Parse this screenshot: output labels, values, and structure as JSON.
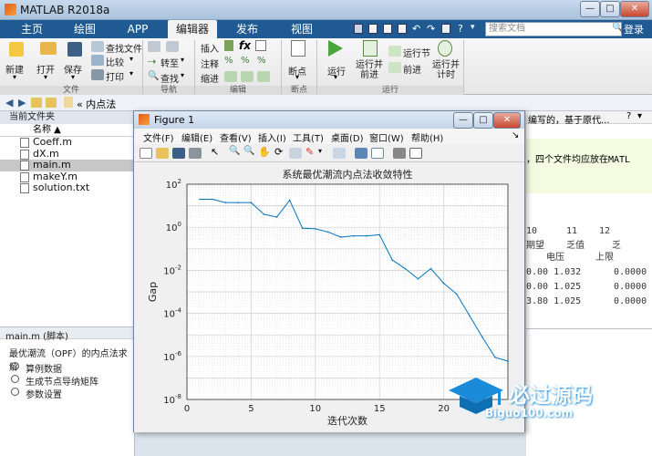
{
  "app": {
    "title": "MATLAB R2018a"
  },
  "tabs": [
    "主页",
    "绘图",
    "APP",
    "编辑器",
    "发布",
    "视图"
  ],
  "active_tab": "编辑器",
  "search": {
    "placeholder": "搜索文档"
  },
  "login": "登录",
  "ribbon": {
    "file": {
      "new": "新建",
      "open": "打开",
      "save": "保存",
      "find_files": "查找文件",
      "compare": "比较",
      "print": "打印",
      "group": "文件"
    },
    "nav": {
      "goto": "转至",
      "find": "查找",
      "group": "导航"
    },
    "edit": {
      "insert": "插入",
      "comment": "注释",
      "indent": "缩进",
      "group": "编辑"
    },
    "breakpoints": {
      "label": "断点",
      "group": "断点"
    },
    "run": {
      "run": "运行",
      "run_advance": "运行并\n前进",
      "run_section": "运行节",
      "advance": "前进",
      "run_time": "运行并\n计时",
      "group": "运行"
    }
  },
  "address": {
    "path": "« 内点法"
  },
  "left_panel": {
    "title": "当前文件夹",
    "col_name": "名称 ▲",
    "files": [
      "Coeff.m",
      "dX.m",
      "main.m",
      "makeY.m",
      "solution.txt"
    ],
    "selected": "main.m",
    "details_title": "main.m  (脚本)",
    "details_desc": "最优潮流（OPF）的内点法求解",
    "sections": [
      "算例数据",
      "生成节点导纳矩阵",
      "参数设置"
    ]
  },
  "right_pane": {
    "top_note": "编写的，基于原代...",
    "note_line": "，四个文件均应放在MATL",
    "headers": [
      "10",
      "11",
      "12"
    ],
    "header2": [
      "期望",
      "乏值",
      "乏"
    ],
    "header3": [
      "电压",
      "上限",
      ""
    ],
    "rows": [
      [
        "0.00 1.032",
        "0.0000"
      ],
      [
        "0.00 1.025",
        "0.0000"
      ],
      [
        "3.80 1.025",
        "0.0000"
      ]
    ]
  },
  "figure": {
    "title": "Figure 1",
    "menus": [
      "文件(F)",
      "编辑(E)",
      "查看(V)",
      "插入(I)",
      "工具(T)",
      "桌面(D)",
      "窗口(W)",
      "帮助(H)"
    ]
  },
  "watermark": {
    "text": "必过源码",
    "sub": "Biguo100.com"
  },
  "chart_data": {
    "type": "line",
    "title": "系统最优潮流内点法收敛特性",
    "xlabel": "迭代次数",
    "ylabel": "Gap",
    "xlim": [
      0,
      25
    ],
    "ylim_log10": [
      -8,
      2
    ],
    "yscale": "log",
    "x_ticks": [
      "0",
      "5",
      "10",
      "15",
      "20"
    ],
    "y_ticks": [
      "10^2",
      "10^0",
      "10^-2",
      "10^-4",
      "10^-6",
      "10^-8"
    ],
    "grid": true,
    "color": "#0072bd",
    "x": [
      1,
      2,
      3,
      4,
      5,
      6,
      7,
      8,
      9,
      10,
      11,
      12,
      13,
      14,
      15,
      16,
      17,
      18,
      19,
      20,
      21,
      22,
      23,
      24,
      25
    ],
    "y": [
      20,
      20,
      14,
      14,
      14,
      4,
      3,
      18,
      0.9,
      0.85,
      0.6,
      0.35,
      0.4,
      0.4,
      0.45,
      0.03,
      0.012,
      0.004,
      0.012,
      0.0025,
      0.0008,
      8e-05,
      8e-06,
      9e-07,
      6e-07
    ]
  }
}
